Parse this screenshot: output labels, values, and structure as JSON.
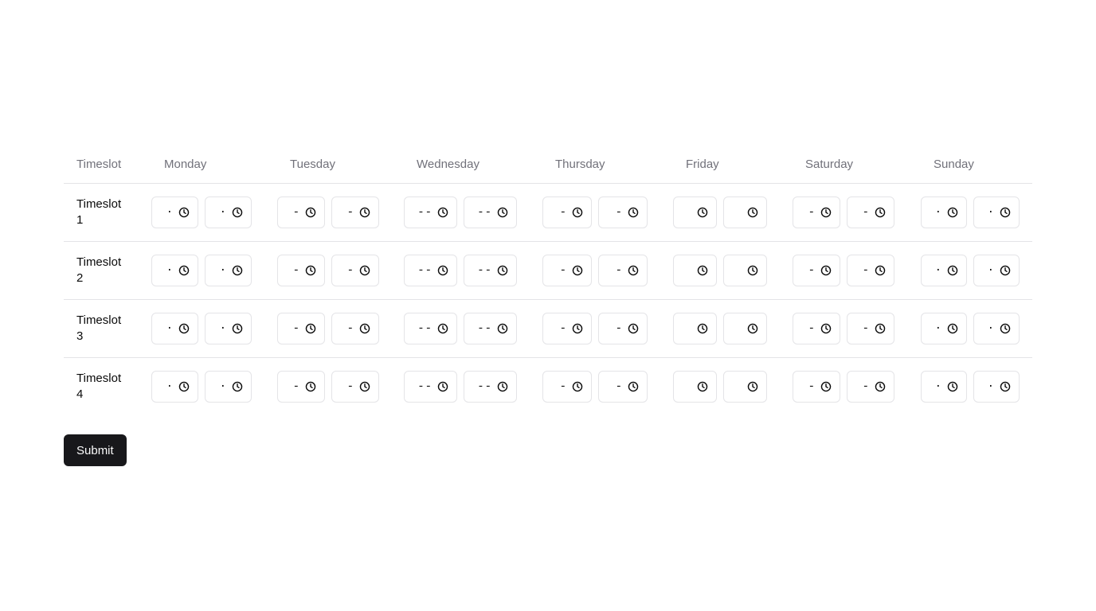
{
  "table": {
    "headers": [
      "Timeslot",
      "Monday",
      "Tuesday",
      "Wednesday",
      "Thursday",
      "Friday",
      "Saturday",
      "Sunday"
    ],
    "rows": [
      {
        "label": "Timeslot 1"
      },
      {
        "label": "Timeslot 2"
      },
      {
        "label": "Timeslot 3"
      },
      {
        "label": "Timeslot 4"
      }
    ],
    "placeholders": {
      "Monday": "·",
      "Tuesday": "-",
      "Wednesday": "--",
      "Thursday": "-",
      "Friday": "",
      "Saturday": "-",
      "Sunday": "·"
    },
    "input_icon": "clock-icon"
  },
  "submit_label": "Submit"
}
